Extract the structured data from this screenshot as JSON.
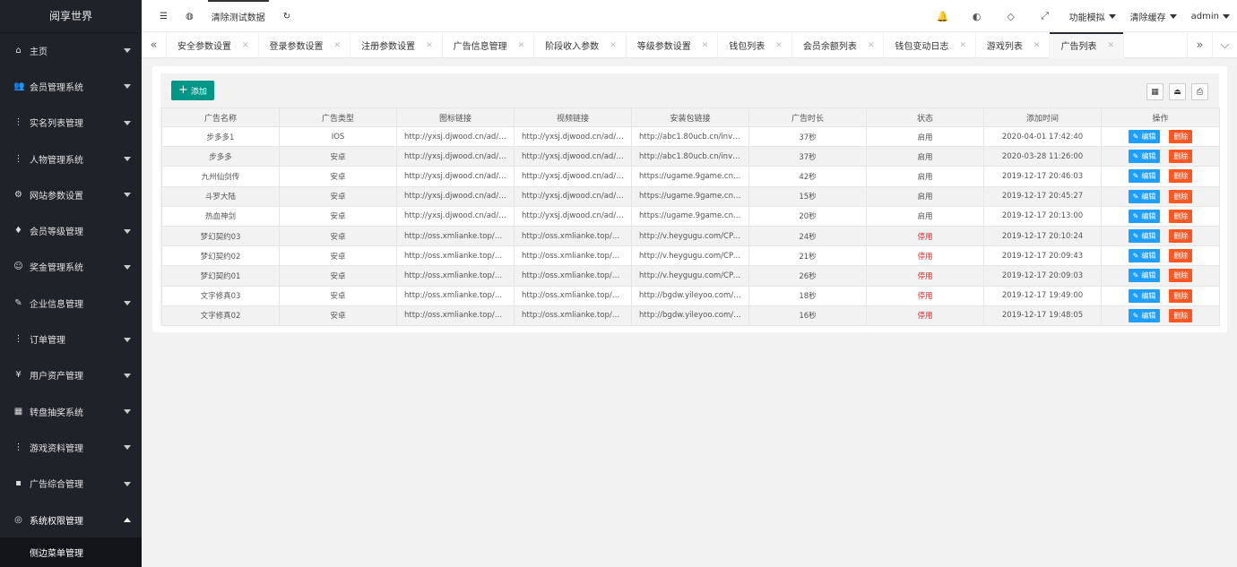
{
  "app": {
    "logo": "阅享世界"
  },
  "sidebar": {
    "items": [
      {
        "label": "主页",
        "icon": "home-icon",
        "glyph": "⌂"
      },
      {
        "label": "会员管理系统",
        "icon": "users-icon",
        "glyph": "👥"
      },
      {
        "label": "实名列表管理",
        "icon": "dots-icon",
        "glyph": "⋮"
      },
      {
        "label": "人物管理系统",
        "icon": "dots-icon",
        "glyph": "⋮"
      },
      {
        "label": "网站参数设置",
        "icon": "gear-icon",
        "glyph": "⚙"
      },
      {
        "label": "会员等级管理",
        "icon": "diamond-icon",
        "glyph": "♦"
      },
      {
        "label": "奖金管理系统",
        "icon": "smile-icon",
        "glyph": "☺"
      },
      {
        "label": "企业信息管理",
        "icon": "edit-icon",
        "glyph": "✎"
      },
      {
        "label": "订单管理",
        "icon": "dots-icon",
        "glyph": "⋮"
      },
      {
        "label": "用户资产管理",
        "icon": "yen-icon",
        "glyph": "¥"
      },
      {
        "label": "转盘抽奖系统",
        "icon": "grid-icon",
        "glyph": "▦"
      },
      {
        "label": "游戏资料管理",
        "icon": "dots-icon",
        "glyph": "⋮"
      },
      {
        "label": "广告综合管理",
        "icon": "chat-icon",
        "glyph": "▪"
      },
      {
        "label": "系统权限管理",
        "icon": "shield-icon",
        "glyph": "◎"
      }
    ],
    "sub_item": "侧边菜单管理"
  },
  "header": {
    "left": [
      {
        "label": "☰",
        "name": "menu-toggle-icon"
      },
      {
        "label": "◍",
        "name": "globe-icon"
      },
      {
        "label": "清除测试数据",
        "name": "clear-test-data-button"
      },
      {
        "label": "↻",
        "name": "refresh-icon"
      }
    ],
    "right_icons": [
      {
        "glyph": "🔔",
        "name": "bell-icon"
      },
      {
        "glyph": "◐",
        "name": "theme-icon"
      },
      {
        "glyph": "◇",
        "name": "tag-icon"
      },
      {
        "glyph": "⤢",
        "name": "fullscreen-icon"
      }
    ],
    "menus": [
      "功能模拟",
      "清除缓存",
      "admin"
    ]
  },
  "tabs": [
    {
      "label": "安全参数设置"
    },
    {
      "label": "登录参数设置"
    },
    {
      "label": "注册参数设置"
    },
    {
      "label": "广告信息管理"
    },
    {
      "label": "阶段收入参数"
    },
    {
      "label": "等级参数设置"
    },
    {
      "label": "钱包列表"
    },
    {
      "label": "会员余额列表"
    },
    {
      "label": "钱包变动日志"
    },
    {
      "label": "游戏列表"
    },
    {
      "label": "广告列表"
    }
  ],
  "toolbar": {
    "add_label": "添加"
  },
  "table": {
    "columns": [
      "广告名称",
      "广告类型",
      "图标链接",
      "视频链接",
      "安装包链接",
      "广告时长",
      "状态",
      "添加时间",
      "操作"
    ],
    "edit_label": "编辑",
    "delete_label": "删除",
    "rows": [
      {
        "name": "步多多1",
        "type": "IOS",
        "icon": "http://yxsj.djwood.cn/ad/b...",
        "video": "http://yxsj.djwood.cn/ad/b...",
        "pkg": "http://abc1.80ucb.cn/invit...",
        "duration": "37秒",
        "status": "启用",
        "enabled": true,
        "time": "2020-04-01 17:42:40"
      },
      {
        "name": "步多多",
        "type": "安卓",
        "icon": "http://yxsj.djwood.cn/ad/b...",
        "video": "http://yxsj.djwood.cn/ad/b...",
        "pkg": "http://abc1.80ucb.cn/invit...",
        "duration": "37秒",
        "status": "启用",
        "enabled": true,
        "time": "2020-03-28 11:26:00"
      },
      {
        "name": "九州仙剑传",
        "type": "安卓",
        "icon": "http://yxsj.djwood.cn/ad/ji...",
        "video": "http://yxsj.djwood.cn/ad/ji...",
        "pkg": "https://ugame.9game.cn/g...",
        "duration": "42秒",
        "status": "启用",
        "enabled": true,
        "time": "2019-12-17 20:46:03"
      },
      {
        "name": "斗罗大陆",
        "type": "安卓",
        "icon": "http://yxsj.djwood.cn/ad/d...",
        "video": "http://yxsj.djwood.cn/ad/d...",
        "pkg": "https://ugame.9game.cn/g...",
        "duration": "15秒",
        "status": "启用",
        "enabled": true,
        "time": "2019-12-17 20:45:27"
      },
      {
        "name": "热血神剑",
        "type": "安卓",
        "icon": "http://yxsj.djwood.cn/ad/re...",
        "video": "http://yxsj.djwood.cn/ad/re...",
        "pkg": "https://ugame.9game.cn/g...",
        "duration": "20秒",
        "status": "启用",
        "enabled": true,
        "time": "2019-12-17 20:13:00"
      },
      {
        "name": "梦幻契约03",
        "type": "安卓",
        "icon": "http://oss.xmlianke.top/m...",
        "video": "http://oss.xmlianke.top/m...",
        "pkg": "http://v.heygugu.com/CPA...",
        "duration": "24秒",
        "status": "停用",
        "enabled": false,
        "time": "2019-12-17 20:10:24"
      },
      {
        "name": "梦幻契约02",
        "type": "安卓",
        "icon": "http://oss.xmlianke.top/m...",
        "video": "http://oss.xmlianke.top/m...",
        "pkg": "http://v.heygugu.com/CPA...",
        "duration": "21秒",
        "status": "停用",
        "enabled": false,
        "time": "2019-12-17 20:09:43"
      },
      {
        "name": "梦幻契约01",
        "type": "安卓",
        "icon": "http://oss.xmlianke.top/m...",
        "video": "http://oss.xmlianke.top/m...",
        "pkg": "http://v.heygugu.com/CPA...",
        "duration": "26秒",
        "status": "停用",
        "enabled": false,
        "time": "2019-12-17 20:09:03"
      },
      {
        "name": "文字修真03",
        "type": "安卓",
        "icon": "http://oss.xmlianke.top/we...",
        "video": "http://oss.xmlianke.top/we...",
        "pkg": "http://bgdw.yileyoo.com/Yi...",
        "duration": "18秒",
        "status": "停用",
        "enabled": false,
        "time": "2019-12-17 19:49:00"
      },
      {
        "name": "文字修真02",
        "type": "安卓",
        "icon": "http://oss.xmlianke.top/we...",
        "video": "http://oss.xmlianke.top/we...",
        "pkg": "http://bgdw.yileyoo.com/Yi...",
        "duration": "16秒",
        "status": "停用",
        "enabled": false,
        "time": "2019-12-17 19:48:05"
      }
    ]
  },
  "colors": {
    "sidebar_bg": "#20222a",
    "primary": "#009688",
    "edit": "#1e9fff",
    "delete": "#ff5722",
    "disabled_text": "#e21e1e"
  }
}
